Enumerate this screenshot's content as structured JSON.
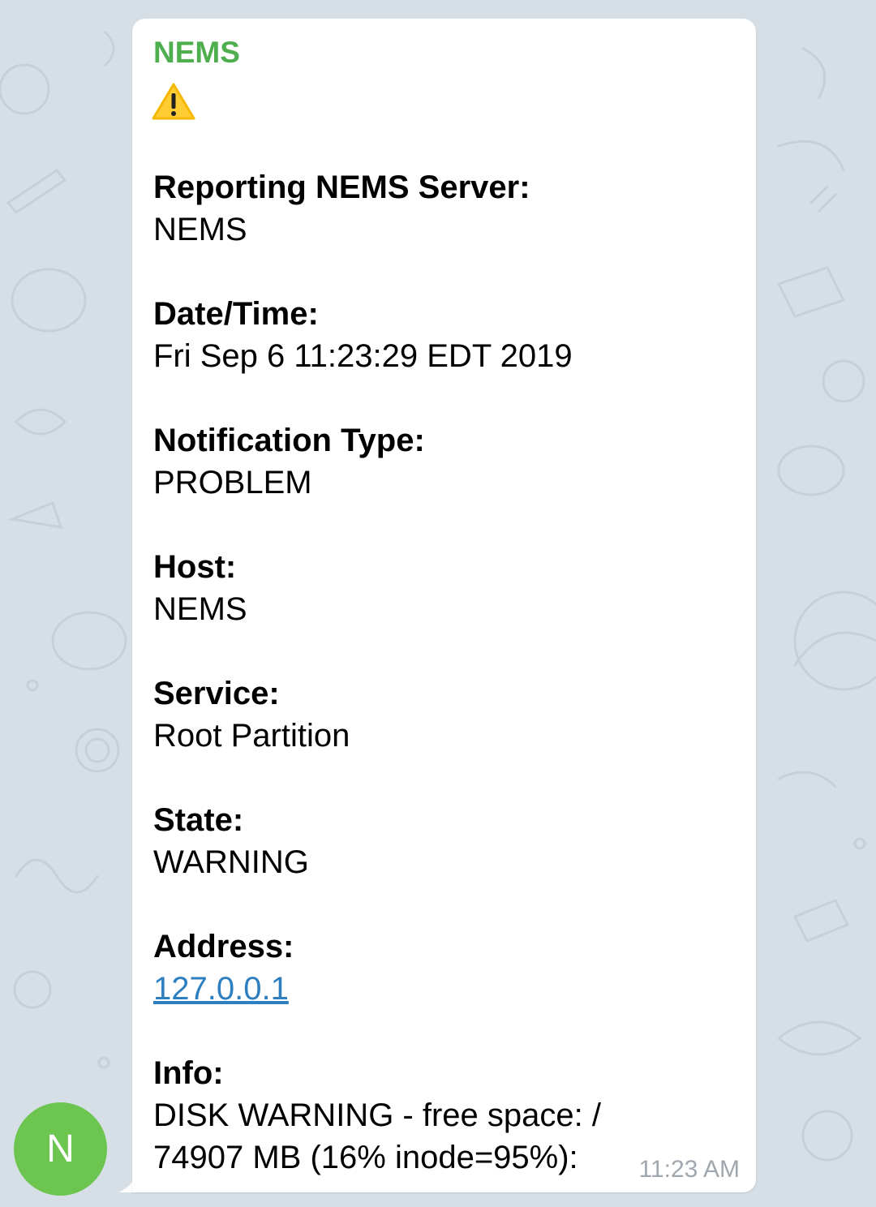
{
  "message": {
    "sender": "NEMS",
    "emoji_icon": "warning-sign-icon",
    "fields": [
      {
        "label": "Reporting NEMS Server:",
        "value": "NEMS"
      },
      {
        "label": "Date/Time:",
        "value": "Fri Sep 6 11:23:29 EDT 2019"
      },
      {
        "label": "Notification Type:",
        "value": "PROBLEM"
      },
      {
        "label": "Host:",
        "value": "NEMS"
      },
      {
        "label": "Service:",
        "value": "Root Partition"
      },
      {
        "label": "State:",
        "value": "WARNING"
      },
      {
        "label": "Address:",
        "value": "127.0.0.1"
      },
      {
        "label": "Info:",
        "value_line1": "DISK WARNING - free space: /",
        "value_line2": "74907 MB (16% inode=95%):"
      }
    ],
    "time": "11:23 AM"
  },
  "avatar": {
    "initial": "N",
    "color": "#6bc54e"
  },
  "colors": {
    "sender": "#4fae4e",
    "link": "#2e7fc0",
    "background": "#d7dfe6"
  }
}
